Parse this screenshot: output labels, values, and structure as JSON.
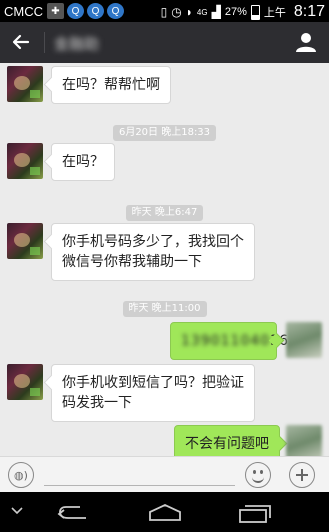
{
  "status_bar": {
    "carrier": "CMCC",
    "network": "4G",
    "battery_percent": "27%",
    "time_period": "上午",
    "time": "8:17"
  },
  "header": {
    "title": "金融助",
    "back_icon": "arrow-left-icon",
    "profile_icon": "person-icon"
  },
  "messages": [
    {
      "type": "incoming",
      "text": "在吗？帮帮忙啊"
    },
    {
      "type": "timestamp",
      "text": "6月20日 晚上18:33"
    },
    {
      "type": "incoming",
      "text": "在吗？"
    },
    {
      "type": "timestamp",
      "text": "昨天 晚上6:47"
    },
    {
      "type": "incoming",
      "line1": "你手机号码多少了，我找回个",
      "line2": "微信号你帮我辅助一下"
    },
    {
      "type": "timestamp",
      "text": "昨天 晚上11:00"
    },
    {
      "type": "outgoing",
      "text_blurred": "139011040",
      "text_tail": "36"
    },
    {
      "type": "incoming",
      "line1": "你手机收到短信了吗？把验证",
      "line2": "码发我一下"
    },
    {
      "type": "outgoing",
      "text": "不会有问题吧"
    }
  ],
  "input_bar": {
    "voice_icon": "voice-icon",
    "emoji_icon": "emoji-icon",
    "plus_icon": "plus-icon"
  },
  "nav_bar": {
    "down_icon": "chevron-down-icon",
    "back_icon": "back-icon",
    "home_icon": "home-icon",
    "recents_icon": "recents-icon"
  },
  "colors": {
    "top_bar": "#2d2d31",
    "chat_bg": "#ebebeb",
    "outgoing_bubble": "#a0e759",
    "timestamp_bg": "#cfcfcf"
  }
}
